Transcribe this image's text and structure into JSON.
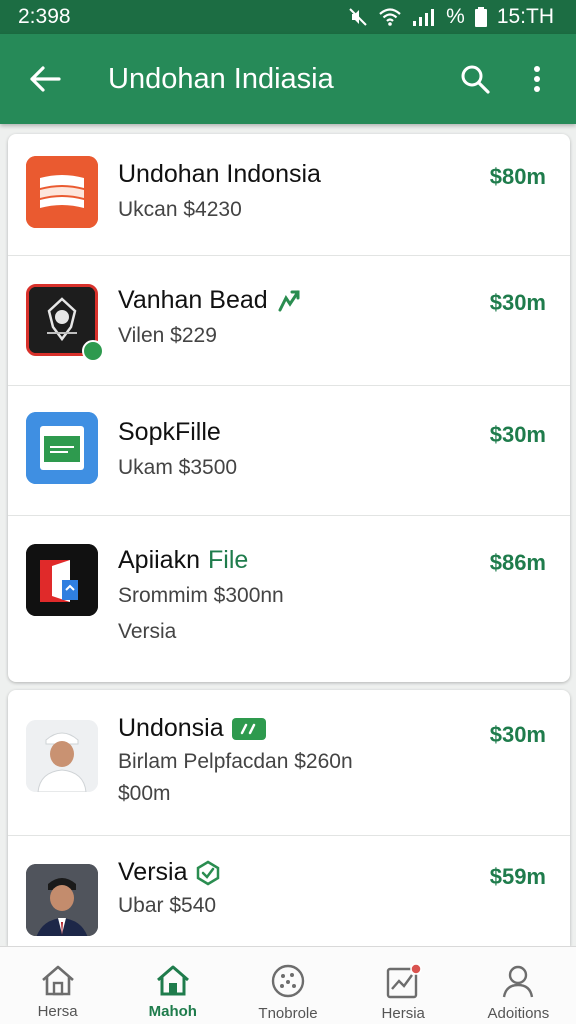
{
  "status_bar": {
    "time_left": "2:398",
    "battery_text": "%",
    "time_right": "15:TH"
  },
  "app_bar": {
    "title": "Undohan Indiasia"
  },
  "items": [
    {
      "title": "Undohan Indonsia",
      "title_green": "",
      "subtitle": "Ukcan $4230",
      "subtitle2": "",
      "price": "$80m"
    },
    {
      "title": "Vanhan Bead",
      "title_green": "",
      "subtitle": "Vilen $229",
      "subtitle2": "",
      "price": "$30m"
    },
    {
      "title": "SopkFille",
      "title_green": "",
      "subtitle": "Ukam $3500",
      "subtitle2": "",
      "price": "$30m"
    },
    {
      "title": "Apiiakn",
      "title_green": "File",
      "subtitle": "Srommim $300nn",
      "subtitle2": "Versia",
      "price": "$86m"
    },
    {
      "title": "Undonsia",
      "title_green": "",
      "subtitle": "Birlam Pelpfacdan  $260n",
      "subtitle2": "$00m",
      "price": "$30m"
    },
    {
      "title": "Versia",
      "title_green": "",
      "subtitle": "Ubar $540",
      "subtitle2": "",
      "price": "$59m"
    }
  ],
  "nav": [
    {
      "label": "Hersa",
      "icon": "house-icon",
      "active": false
    },
    {
      "label": "Mahoh",
      "icon": "house-icon",
      "active": true
    },
    {
      "label": "Tnobrole",
      "icon": "dots-circle-icon",
      "active": false
    },
    {
      "label": "Hersia",
      "icon": "chart-badge-icon",
      "active": false
    },
    {
      "label": "Adoitions",
      "icon": "person-icon",
      "active": false
    }
  ],
  "colors": {
    "primary": "#268a58",
    "status_bar": "#1c6d43",
    "price_green": "#1f7c4c"
  }
}
